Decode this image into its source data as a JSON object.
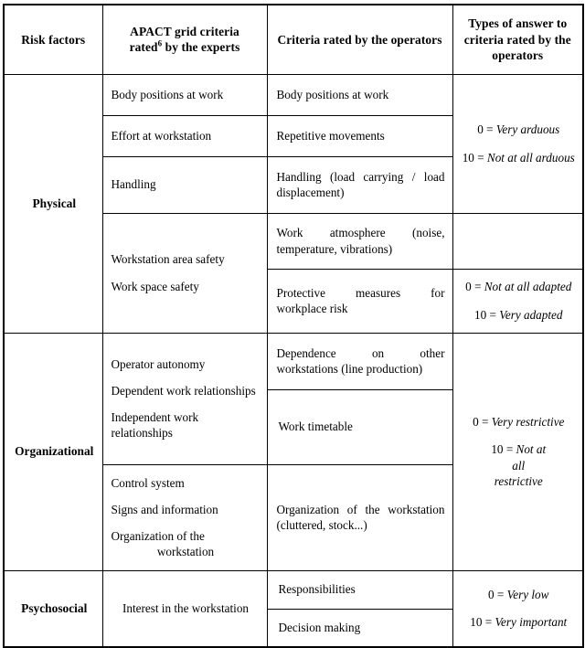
{
  "table": {
    "headers": [
      "Risk factors",
      "APACT grid criteria rated 6 by the experts",
      "Criteria rated by the operators",
      "Types of answer to criteria rated by the operators"
    ],
    "header_parts": {
      "col2_line1": "APACT grid criteria",
      "col2_line2_a": "rated",
      "col2_footnote": "6",
      "col2_line2_b": "by the experts",
      "col1": "Risk factors",
      "col3": "Criteria rated by the operators",
      "col4": "Types of answer to criteria rated by the operators"
    },
    "risk_factors": {
      "physical": "Physical",
      "organizational": "Organizational",
      "psychosocial": "Psychosocial"
    },
    "expert_criteria": {
      "physical_1": "Body positions at work",
      "physical_2": "Effort at workstation",
      "physical_3": "Handling",
      "physical_4_a": "Workstation area safety",
      "physical_4_b": "Work space safety",
      "organizational_1_a": "Operator autonomy",
      "organizational_1_b": "Dependent work relationships",
      "organizational_1_c": "Independent work relationships",
      "organizational_2_a": "Control system",
      "organizational_2_b": "Signs and information",
      "organizational_2_c_l1": "Organization        of        the",
      "organizational_2_c_l2": "workstation",
      "psychosocial_1": "Interest in the workstation"
    },
    "operator_criteria": {
      "physical_1": "Body positions at work",
      "physical_2": "Repetitive movements",
      "physical_3_l1": "Handling (load carrying / load",
      "physical_3_l2": "displacement)",
      "physical_4_l1": "Work atmosphere (noise,",
      "physical_4_l2": "temperature, vibrations)",
      "physical_5_l1": "Protective measures for",
      "physical_5_l2": "workplace risk",
      "organizational_1_l1": "Dependence on other",
      "organizational_1_l2": "workstations (line production)",
      "organizational_2": "Work timetable",
      "organizational_3_l1": "Organization of the workstation",
      "organizational_3_l2": "(cluttered, stock...)",
      "psychosocial_1": "Responsibilities",
      "psychosocial_2": "Decision making"
    },
    "answer_types": {
      "arduous": {
        "line1_num": "0 = ",
        "line1_text": "Very arduous",
        "line2_num": "10 = ",
        "line2_text": "Not at all arduous"
      },
      "adapted": {
        "line1_num": "0 = ",
        "line1_text": "Not at all adapted",
        "line2_num": "10 = ",
        "line2_text": "Very adapted"
      },
      "restrictive": {
        "line1_num": "0 = ",
        "line1_text": "Very restrictive",
        "line2_num": "10 = ",
        "line2_text": "Not at all restrictive"
      },
      "importance": {
        "line1_num": "0 = ",
        "line1_text": "Very low",
        "line2_num": "10 = ",
        "line2_text": "Very important"
      }
    }
  }
}
